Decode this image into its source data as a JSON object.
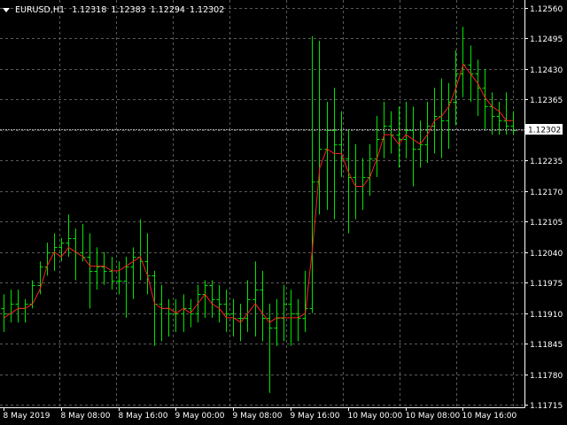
{
  "header": {
    "symbol_timeframe": "EURUSD,H1",
    "open": "1.12318",
    "high": "1.12383",
    "low": "1.12294",
    "close": "1.12302"
  },
  "colors": {
    "background": "#000000",
    "grid": "#5a5a5a",
    "bull_bar": "#00e400",
    "bear_bar": "#00e400",
    "moving_average": "#ff2020",
    "text": "#ffffff",
    "bid_line": "#a9a9a9",
    "price_tag_bg": "#ffffff",
    "price_tag_text": "#000000"
  },
  "chart_data": {
    "type": "ohlc-bars",
    "symbol": "EURUSD",
    "timeframe": "H1",
    "grid": true,
    "bid_line": 1.12302,
    "ylim": [
      1.1171,
      1.1257
    ],
    "y_ticks": [
      "1.12560",
      "1.12495",
      "1.12430",
      "1.12365",
      "1.12300",
      "1.12235",
      "1.12170",
      "1.12105",
      "1.12040",
      "1.11975",
      "1.11910",
      "1.11845",
      "1.11780",
      "1.11715"
    ],
    "current_price_label": "1.12302",
    "x_labels": [
      {
        "bar": 0,
        "label": "8 May 2019"
      },
      {
        "bar": 8,
        "label": "8 May 08:00"
      },
      {
        "bar": 16,
        "label": "8 May 16:00"
      },
      {
        "bar": 24,
        "label": "9 May 00:00"
      },
      {
        "bar": 32,
        "label": "9 May 08:00"
      },
      {
        "bar": 40,
        "label": "9 May 16:00"
      },
      {
        "bar": 48,
        "label": "10 May 00:00"
      },
      {
        "bar": 56,
        "label": "10 May 08:00"
      },
      {
        "bar": 64,
        "label": "10 May 16:00"
      }
    ],
    "ohlc": [
      [
        1.1192,
        1.1195,
        1.1187,
        1.1191
      ],
      [
        1.1191,
        1.1196,
        1.1189,
        1.1193
      ],
      [
        1.1193,
        1.1196,
        1.1189,
        1.1192
      ],
      [
        1.1192,
        1.1194,
        1.1189,
        1.1193
      ],
      [
        1.1193,
        1.1198,
        1.1192,
        1.1197
      ],
      [
        1.1197,
        1.1202,
        1.1195,
        1.1201
      ],
      [
        1.1201,
        1.1206,
        1.1199,
        1.1204
      ],
      [
        1.1204,
        1.1208,
        1.12,
        1.1205
      ],
      [
        1.1205,
        1.1207,
        1.1202,
        1.1206
      ],
      [
        1.1206,
        1.1212,
        1.1203,
        1.1207
      ],
      [
        1.1207,
        1.1209,
        1.1198,
        1.1204
      ],
      [
        1.1204,
        1.121,
        1.1202,
        1.1203
      ],
      [
        1.1203,
        1.1208,
        1.1192,
        1.12
      ],
      [
        1.12,
        1.1205,
        1.1196,
        1.1201
      ],
      [
        1.1201,
        1.1204,
        1.1197,
        1.12
      ],
      [
        1.12,
        1.1203,
        1.1196,
        1.1198
      ],
      [
        1.1198,
        1.1202,
        1.1195,
        1.1198
      ],
      [
        1.1198,
        1.1203,
        1.119,
        1.1201
      ],
      [
        1.1201,
        1.1205,
        1.1194,
        1.1203
      ],
      [
        1.1203,
        1.1211,
        1.1198,
        1.1202
      ],
      [
        1.1202,
        1.1208,
        1.1195,
        1.1199
      ],
      [
        1.1199,
        1.12,
        1.1184,
        1.1193
      ],
      [
        1.1193,
        1.1197,
        1.1185,
        1.1192
      ],
      [
        1.1192,
        1.1194,
        1.1186,
        1.1191
      ],
      [
        1.1191,
        1.1194,
        1.1187,
        1.1191
      ],
      [
        1.1191,
        1.1195,
        1.1187,
        1.1192
      ],
      [
        1.1192,
        1.1194,
        1.1188,
        1.1191
      ],
      [
        1.1191,
        1.1197,
        1.1189,
        1.1195
      ],
      [
        1.1195,
        1.1198,
        1.119,
        1.1197
      ],
      [
        1.1197,
        1.1198,
        1.119,
        1.1194
      ],
      [
        1.1194,
        1.1197,
        1.1189,
        1.1193
      ],
      [
        1.1193,
        1.1196,
        1.1187,
        1.1191
      ],
      [
        1.1191,
        1.1194,
        1.1186,
        1.119
      ],
      [
        1.119,
        1.1193,
        1.1185,
        1.119
      ],
      [
        1.119,
        1.1198,
        1.1187,
        1.1194
      ],
      [
        1.1194,
        1.1202,
        1.1186,
        1.1196
      ],
      [
        1.1196,
        1.12,
        1.1185,
        1.119
      ],
      [
        1.119,
        1.1193,
        1.1174,
        1.1188
      ],
      [
        1.1188,
        1.1194,
        1.1184,
        1.119
      ],
      [
        1.119,
        1.1197,
        1.1185,
        1.1193
      ],
      [
        1.1193,
        1.1196,
        1.1184,
        1.1191
      ],
      [
        1.1191,
        1.1194,
        1.1185,
        1.119
      ],
      [
        1.119,
        1.12,
        1.1187,
        1.1192
      ],
      [
        1.1192,
        1.125,
        1.1191,
        1.1219
      ],
      [
        1.1219,
        1.1249,
        1.1212,
        1.1226
      ],
      [
        1.1226,
        1.1236,
        1.1213,
        1.123
      ],
      [
        1.123,
        1.1239,
        1.1211,
        1.1227
      ],
      [
        1.1227,
        1.1234,
        1.122,
        1.1224
      ],
      [
        1.1224,
        1.123,
        1.1208,
        1.122
      ],
      [
        1.122,
        1.1227,
        1.1211,
        1.1218
      ],
      [
        1.1218,
        1.1224,
        1.1213,
        1.122
      ],
      [
        1.122,
        1.1227,
        1.1216,
        1.1224
      ],
      [
        1.1224,
        1.1233,
        1.122,
        1.1228
      ],
      [
        1.1228,
        1.1236,
        1.1224,
        1.1231
      ],
      [
        1.1231,
        1.1234,
        1.1225,
        1.1229
      ],
      [
        1.1229,
        1.1235,
        1.1222,
        1.1228
      ],
      [
        1.1228,
        1.1236,
        1.1224,
        1.123
      ],
      [
        1.123,
        1.1235,
        1.1218,
        1.1226
      ],
      [
        1.1226,
        1.1232,
        1.1222,
        1.1227
      ],
      [
        1.1227,
        1.1236,
        1.1223,
        1.1231
      ],
      [
        1.1231,
        1.1239,
        1.1225,
        1.1233
      ],
      [
        1.1233,
        1.1241,
        1.1224,
        1.1232
      ],
      [
        1.1232,
        1.124,
        1.1226,
        1.1236
      ],
      [
        1.1236,
        1.1247,
        1.1231,
        1.1242
      ],
      [
        1.1242,
        1.1252,
        1.1237,
        1.1244
      ],
      [
        1.1244,
        1.1248,
        1.1236,
        1.1242
      ],
      [
        1.1242,
        1.1245,
        1.1233,
        1.1239
      ],
      [
        1.1239,
        1.1243,
        1.123,
        1.1235
      ],
      [
        1.1235,
        1.1238,
        1.1229,
        1.1233
      ],
      [
        1.1233,
        1.1236,
        1.1229,
        1.1232
      ],
      [
        1.1232,
        1.1238,
        1.1229,
        1.1231
      ],
      [
        1.1231,
        1.1234,
        1.1229,
        1.123
      ]
    ],
    "ma": [
      1.119,
      1.1191,
      1.1192,
      1.1192,
      1.1193,
      1.1196,
      1.1201,
      1.1204,
      1.1203,
      1.1205,
      1.1204,
      1.1203,
      1.1201,
      1.1201,
      1.1201,
      1.12,
      1.12,
      1.1201,
      1.1202,
      1.1203,
      1.1199,
      1.1193,
      1.1192,
      1.1192,
      1.1191,
      1.1192,
      1.1191,
      1.1193,
      1.1195,
      1.1193,
      1.1192,
      1.119,
      1.119,
      1.1189,
      1.1191,
      1.1193,
      1.1191,
      1.1189,
      1.119,
      1.119,
      1.119,
      1.119,
      1.1191,
      1.1205,
      1.1222,
      1.1226,
      1.1225,
      1.1225,
      1.1221,
      1.1218,
      1.1218,
      1.122,
      1.1224,
      1.1229,
      1.1229,
      1.1227,
      1.1229,
      1.1228,
      1.1227,
      1.1229,
      1.1232,
      1.1233,
      1.1235,
      1.1239,
      1.1244,
      1.1242,
      1.124,
      1.1237,
      1.1235,
      1.1234,
      1.1232,
      1.1232
    ]
  }
}
